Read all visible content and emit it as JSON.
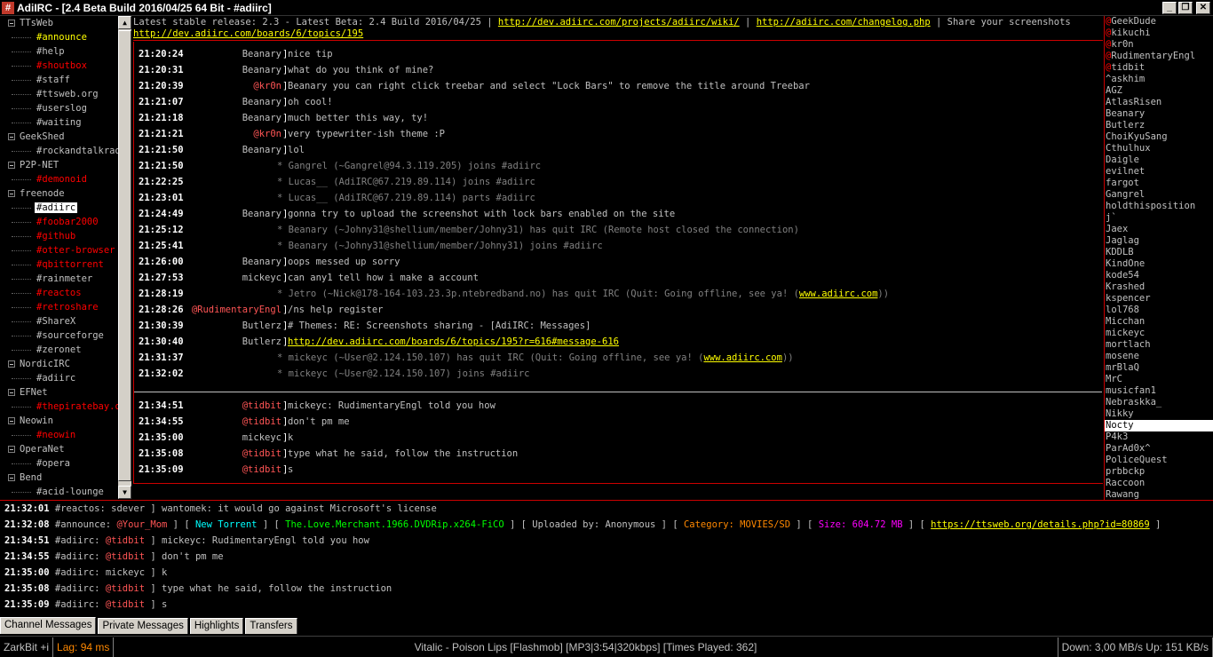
{
  "window": {
    "icon": "#",
    "title": "AdiIRC - [2.4 Beta Build 2016/04/25 64 Bit - #adiirc]",
    "min": "_",
    "restore": "❐",
    "close": "✕"
  },
  "treebar": [
    {
      "type": "net",
      "label": "TTsWeb"
    },
    {
      "type": "chan",
      "label": "#announce",
      "color": "y"
    },
    {
      "type": "chan",
      "label": "#help",
      "color": "g"
    },
    {
      "type": "chan",
      "label": "#shoutbox",
      "color": "r"
    },
    {
      "type": "chan",
      "label": "#staff",
      "color": "g"
    },
    {
      "type": "chan",
      "label": "#ttsweb.org",
      "color": "g"
    },
    {
      "type": "chan",
      "label": "#userslog",
      "color": "g"
    },
    {
      "type": "chan",
      "label": "#waiting",
      "color": "g"
    },
    {
      "type": "net",
      "label": "GeekShed"
    },
    {
      "type": "chan",
      "label": "#rockandtalkradio",
      "color": "g"
    },
    {
      "type": "net",
      "label": "P2P-NET"
    },
    {
      "type": "chan",
      "label": "#demonoid",
      "color": "r"
    },
    {
      "type": "net",
      "label": "freenode"
    },
    {
      "type": "chan",
      "label": "#adiirc",
      "color": "g",
      "active": true
    },
    {
      "type": "chan",
      "label": "#foobar2000",
      "color": "r"
    },
    {
      "type": "chan",
      "label": "#github",
      "color": "r"
    },
    {
      "type": "chan",
      "label": "#otter-browser",
      "color": "r"
    },
    {
      "type": "chan",
      "label": "#qbittorrent",
      "color": "r"
    },
    {
      "type": "chan",
      "label": "#rainmeter",
      "color": "g"
    },
    {
      "type": "chan",
      "label": "#reactos",
      "color": "r"
    },
    {
      "type": "chan",
      "label": "#retroshare",
      "color": "r"
    },
    {
      "type": "chan",
      "label": "#ShareX",
      "color": "g"
    },
    {
      "type": "chan",
      "label": "#sourceforge",
      "color": "g"
    },
    {
      "type": "chan",
      "label": "#zeronet",
      "color": "g"
    },
    {
      "type": "net",
      "label": "NordicIRC"
    },
    {
      "type": "chan",
      "label": "#adiirc",
      "color": "g"
    },
    {
      "type": "net",
      "label": "EFNet"
    },
    {
      "type": "chan",
      "label": "#thepiratebay.org",
      "color": "r"
    },
    {
      "type": "net",
      "label": "Neowin"
    },
    {
      "type": "chan",
      "label": "#neowin",
      "color": "r"
    },
    {
      "type": "net",
      "label": "OperaNet"
    },
    {
      "type": "chan",
      "label": "#opera",
      "color": "g"
    },
    {
      "type": "net",
      "label": "Bend"
    },
    {
      "type": "chan",
      "label": "#acid-lounge",
      "color": "g"
    }
  ],
  "topic": {
    "text": "Latest stable release: 2.3 - Latest Beta: 2.4 Build 2016/04/25 | ",
    "link1": "http://dev.adiirc.com/projects/adiirc/wiki/",
    "sep": " | ",
    "link2": "http://adiirc.com/changelog.php",
    "text2": " | Share your screenshots",
    "link3": "http://dev.adiirc.com/boards/6/topics/195"
  },
  "messages": [
    {
      "ts": "21:20:24",
      "nick": "Beanary",
      "text": "nice tip"
    },
    {
      "ts": "21:20:31",
      "nick": "Beanary",
      "text": "what do you think of mine?"
    },
    {
      "ts": "21:20:39",
      "nick": "@kr0n",
      "op": true,
      "text": "Beanary you can right click treebar and select \"Lock Bars\" to remove the title around Treebar"
    },
    {
      "ts": "21:21:07",
      "nick": "Beanary",
      "text": "oh cool!"
    },
    {
      "ts": "21:21:18",
      "nick": "Beanary",
      "text": "much better this way, ty!"
    },
    {
      "ts": "21:21:21",
      "nick": "@kr0n",
      "op": true,
      "text": "very typewriter-ish theme :P"
    },
    {
      "ts": "21:21:50",
      "nick": "Beanary",
      "text": "lol"
    },
    {
      "ts": "21:21:50",
      "event": "* Gangrel (~Gangrel@94.3.119.205) joins #adiirc"
    },
    {
      "ts": "21:22:25",
      "event": "* Lucas__ (AdiIRC@67.219.89.114) joins #adiirc"
    },
    {
      "ts": "21:23:01",
      "event": "* Lucas__ (AdiIRC@67.219.89.114) parts #adiirc"
    },
    {
      "ts": "21:24:49",
      "nick": "Beanary",
      "text": "gonna try to upload the screenshot with lock bars enabled on the site"
    },
    {
      "ts": "21:25:12",
      "event": "* Beanary (~Johny31@shellium/member/Johny31) has quit IRC (Remote host closed the connection)"
    },
    {
      "ts": "21:25:41",
      "event": "* Beanary (~Johny31@shellium/member/Johny31) joins #adiirc"
    },
    {
      "ts": "21:26:00",
      "nick": "Beanary",
      "text": "oops messed up sorry"
    },
    {
      "ts": "21:27:53",
      "nick": "mickeyc",
      "text": "can any1 tell how  i make a account"
    },
    {
      "ts": "21:28:19",
      "event": "* Jetro (~Nick@178-164-103.23.3p.ntebredband.no) has quit IRC (Quit: Going offline, see ya! (",
      "link": "www.adiirc.com",
      "tail": "))"
    },
    {
      "ts": "21:28:26",
      "nick": "@RudimentaryEngl",
      "op": true,
      "text": "/ns help register"
    },
    {
      "ts": "21:30:39",
      "nick": "Butlerz",
      "text": "#  Themes: RE: Screenshots sharing - [AdiIRC: Messages]"
    },
    {
      "ts": "21:30:40",
      "nick": "Butlerz",
      "text": " ",
      "link": "http://dev.adiirc.com/boards/6/topics/195?r=616#message-616"
    },
    {
      "ts": "21:31:37",
      "event": "* mickeyc (~User@2.124.150.107) has quit IRC (Quit: Going offline, see ya! (",
      "link": "www.adiirc.com",
      "tail": "))"
    },
    {
      "ts": "21:32:02",
      "event": "* mickeyc (~User@2.124.150.107) joins #adiirc"
    },
    {
      "ts": "21:34:51",
      "nick": "@tidbit",
      "op": true,
      "text": "mickeyc: RudimentaryEngl told you how"
    },
    {
      "ts": "21:34:55",
      "nick": "@tidbit",
      "op": true,
      "text": "don't pm me"
    },
    {
      "ts": "21:35:00",
      "nick": "mickeyc",
      "text": "k"
    },
    {
      "ts": "21:35:08",
      "nick": "@tidbit",
      "op": true,
      "text": "type what he said, follow the instruction"
    },
    {
      "ts": "21:35:09",
      "nick": "@tidbit",
      "op": true,
      "text": "s"
    }
  ],
  "nicklist": [
    {
      "p": "@",
      "n": "GeekDude"
    },
    {
      "p": "@",
      "n": "kikuchi"
    },
    {
      "p": "@",
      "n": "kr0n"
    },
    {
      "p": "@",
      "n": "RudimentaryEngl"
    },
    {
      "p": "@",
      "n": "tidbit"
    },
    {
      "p": "",
      "n": "^askhim"
    },
    {
      "p": "",
      "n": "AGZ"
    },
    {
      "p": "",
      "n": "AtlasRisen"
    },
    {
      "p": "",
      "n": "Beanary"
    },
    {
      "p": "",
      "n": "Butlerz"
    },
    {
      "p": "",
      "n": "ChoiKyuSang"
    },
    {
      "p": "",
      "n": "Cthulhux"
    },
    {
      "p": "",
      "n": "Daigle"
    },
    {
      "p": "",
      "n": "evilnet"
    },
    {
      "p": "",
      "n": "fargot"
    },
    {
      "p": "",
      "n": "Gangrel"
    },
    {
      "p": "",
      "n": "holdthisposition"
    },
    {
      "p": "",
      "n": "j`"
    },
    {
      "p": "",
      "n": "Jaex"
    },
    {
      "p": "",
      "n": "Jaglag"
    },
    {
      "p": "",
      "n": "KDDLB"
    },
    {
      "p": "",
      "n": "KindOne"
    },
    {
      "p": "",
      "n": "kode54"
    },
    {
      "p": "",
      "n": "Krashed"
    },
    {
      "p": "",
      "n": "kspencer"
    },
    {
      "p": "",
      "n": "lol768"
    },
    {
      "p": "",
      "n": "Micchan"
    },
    {
      "p": "",
      "n": "mickeyc"
    },
    {
      "p": "",
      "n": "mortlach"
    },
    {
      "p": "",
      "n": "mosene"
    },
    {
      "p": "",
      "n": "mrBlaQ"
    },
    {
      "p": "",
      "n": "MrC"
    },
    {
      "p": "",
      "n": "musicfan1"
    },
    {
      "p": "",
      "n": "Nebraskka_"
    },
    {
      "p": "",
      "n": "Nikky"
    },
    {
      "p": "",
      "n": "Nocty",
      "sel": true
    },
    {
      "p": "",
      "n": "P4k3"
    },
    {
      "p": "",
      "n": "ParAd0x^"
    },
    {
      "p": "",
      "n": "PoliceQuest"
    },
    {
      "p": "",
      "n": "prbbckp"
    },
    {
      "p": "",
      "n": "Raccoon"
    },
    {
      "p": "",
      "n": "Rawang"
    }
  ],
  "monitor": {
    "l1": {
      "ts": "21:32:01",
      "chan": "#reactos:",
      "text": " sdever ] wantomek: it would go against Microsoft's license"
    },
    "l2": {
      "ts": "21:32:08",
      "chan": "#announce:",
      "nick": "@Your_Mom",
      "a": " ] [ ",
      "b": "New Torrent",
      "c": " ] [ ",
      "d": "The.Love.Merchant.1966.DVDRip.x264-FiCO",
      "e": " ] [ Uploaded by: Anonymous ] [ ",
      "f": "Category: MOVIES/SD",
      "g": " ] [ ",
      "h": "Size:  604.72 MB",
      "i": "  ] [ ",
      "link": "https://ttsweb.org/details.php?id=80869",
      "j": " ]"
    },
    "l3": {
      "ts": "21:34:51",
      "chan": "#adiirc:",
      "nick": "@tidbit",
      "text": " ] mickeyc: RudimentaryEngl told you how"
    },
    "l4": {
      "ts": "21:34:55",
      "chan": "#adiirc:",
      "nick": "@tidbit",
      "text": " ] don't pm me"
    },
    "l5": {
      "ts": "21:35:00",
      "chan": "#adiirc:",
      "nick": "mickeyc",
      "text": " ] k"
    },
    "l6": {
      "ts": "21:35:08",
      "chan": "#adiirc:",
      "nick": "@tidbit",
      "text": " ] type what he said, follow the instruction"
    },
    "l7": {
      "ts": "21:35:09",
      "chan": "#adiirc:",
      "nick": "@tidbit",
      "text": " ] s"
    }
  },
  "tabs": [
    "Channel Messages",
    "Private Messages",
    "Highlights",
    "Transfers"
  ],
  "status": {
    "nick": "ZarkBit +i",
    "lag": "Lag: 94 ms",
    "song": "Vitalic - Poison Lips [Flashmob] [MP3|3:54|320kbps] [Times Played: 362]",
    "speed": "Down: 3,00 MB/s Up: 151 KB/s"
  }
}
